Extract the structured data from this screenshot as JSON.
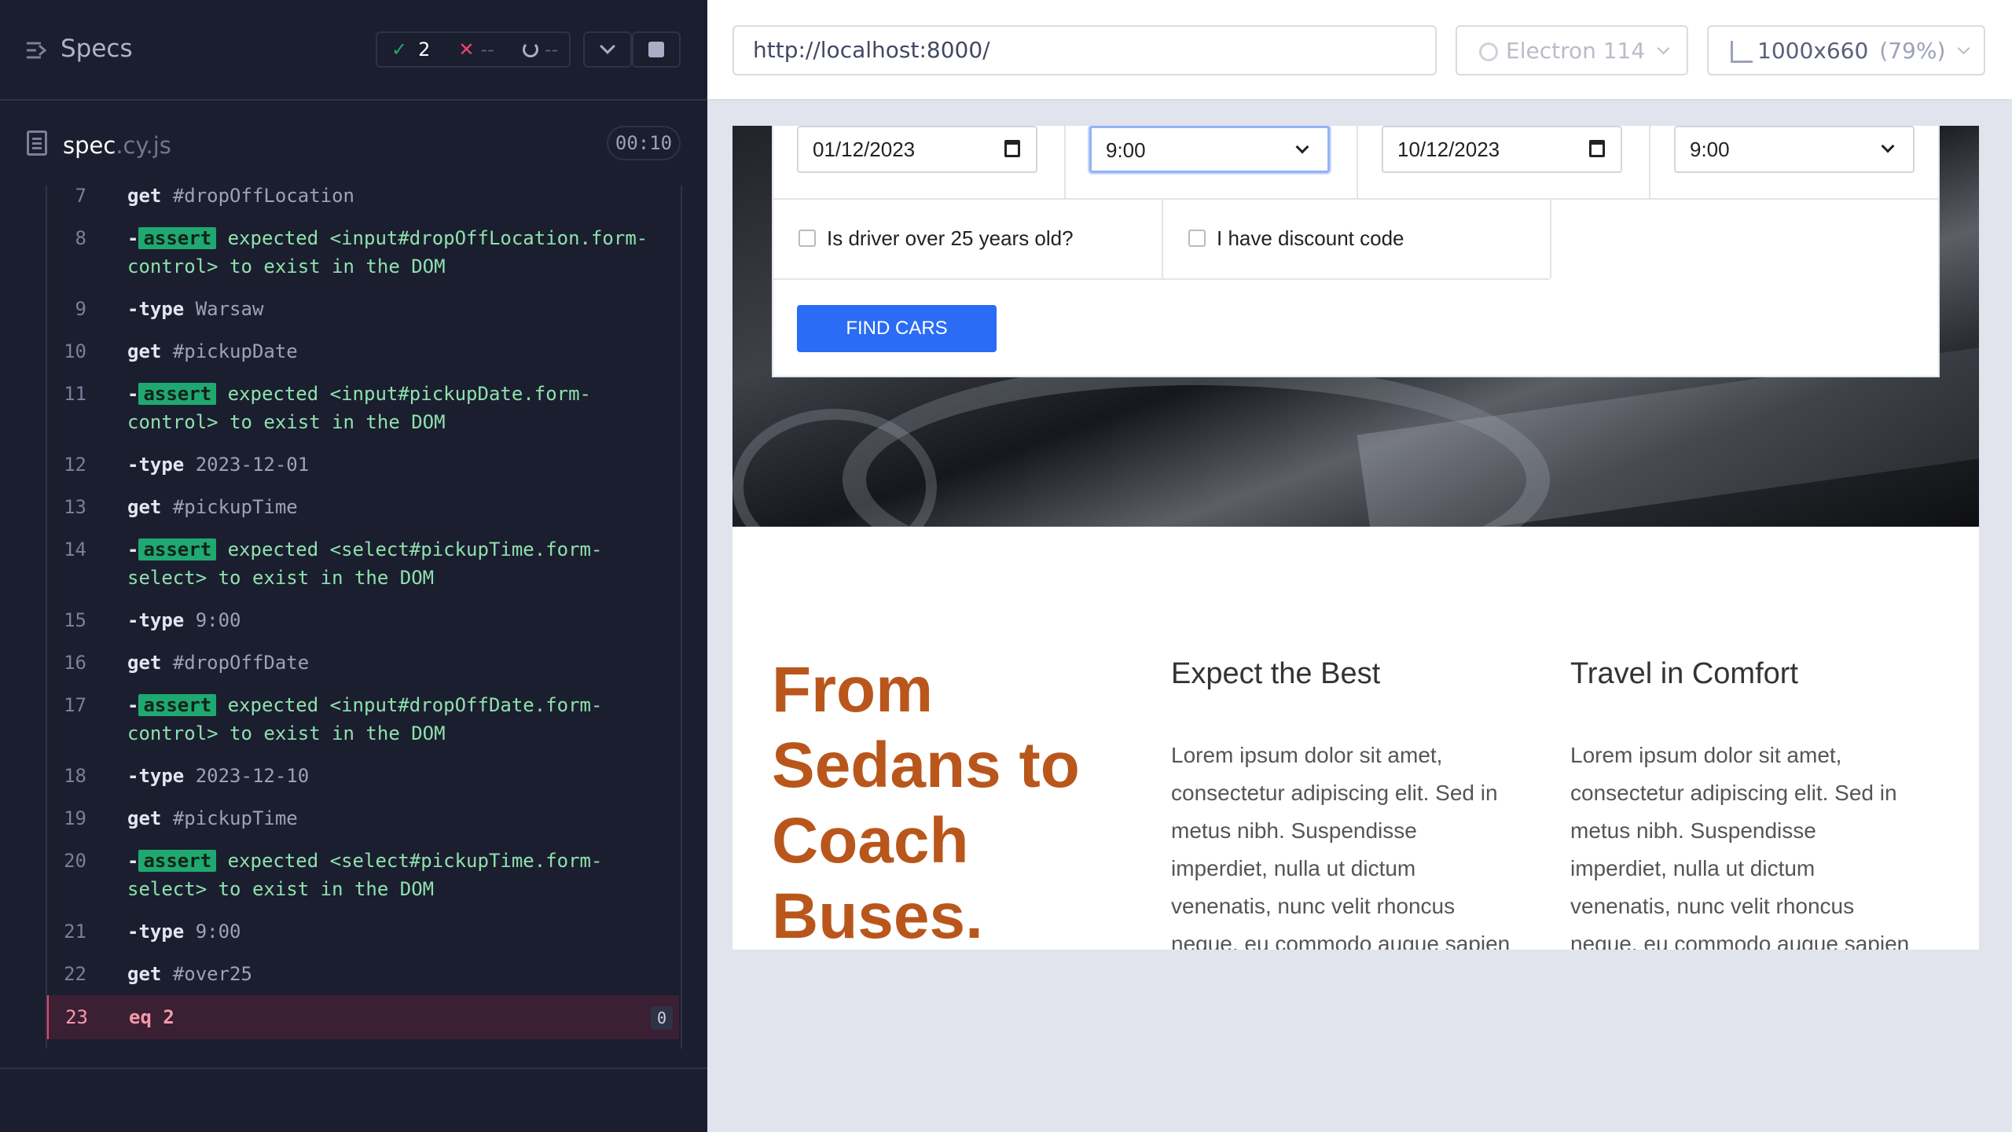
{
  "reporter": {
    "title": "Specs",
    "stats": {
      "passed": "2",
      "failed": "--",
      "pending": "--"
    },
    "spec_file": {
      "name": "spec",
      "ext": ".cy.js"
    },
    "duration": "00:10"
  },
  "commands": [
    {
      "num": "7",
      "name": "get",
      "msg": "#dropOffLocation",
      "kind": "get"
    },
    {
      "num": "8",
      "name": "assert",
      "msg": "expected <input#dropOffLocation.form-control> to exist in the DOM",
      "kind": "assert"
    },
    {
      "num": "9",
      "name": "type",
      "msg": "Warsaw",
      "kind": "child"
    },
    {
      "num": "10",
      "name": "get",
      "msg": "#pickupDate",
      "kind": "get"
    },
    {
      "num": "11",
      "name": "assert",
      "msg": "expected <input#pickupDate.form-control> to exist in the DOM",
      "kind": "assert"
    },
    {
      "num": "12",
      "name": "type",
      "msg": "2023-12-01",
      "kind": "child"
    },
    {
      "num": "13",
      "name": "get",
      "msg": "#pickupTime",
      "kind": "get"
    },
    {
      "num": "14",
      "name": "assert",
      "msg": "expected <select#pickupTime.form-select> to exist in the DOM",
      "kind": "assert"
    },
    {
      "num": "15",
      "name": "type",
      "msg": "9:00",
      "kind": "child"
    },
    {
      "num": "16",
      "name": "get",
      "msg": "#dropOffDate",
      "kind": "get"
    },
    {
      "num": "17",
      "name": "assert",
      "msg": "expected <input#dropOffDate.form-control> to exist in the DOM",
      "kind": "assert"
    },
    {
      "num": "18",
      "name": "type",
      "msg": "2023-12-10",
      "kind": "child"
    },
    {
      "num": "19",
      "name": "get",
      "msg": "#pickupTime",
      "kind": "get"
    },
    {
      "num": "20",
      "name": "assert",
      "msg": "expected <select#pickupTime.form-select> to exist in the DOM",
      "kind": "assert"
    },
    {
      "num": "21",
      "name": "type",
      "msg": "9:00",
      "kind": "child"
    },
    {
      "num": "22",
      "name": "get",
      "msg": "#over25",
      "kind": "get"
    },
    {
      "num": "23",
      "name": "eq",
      "msg": "2",
      "kind": "active",
      "badge": "0"
    }
  ],
  "aut": {
    "url": "http://localhost:8000/",
    "browser": "Electron 114",
    "viewport": "1000x660",
    "scale": "(79%)"
  },
  "page": {
    "pickup_date": "01/12/2023",
    "pickup_time": "9:00",
    "dropoff_date": "10/12/2023",
    "dropoff_time": "9:00",
    "over25_label": "Is driver over 25 years old?",
    "discount_label": "I have discount code",
    "find_button": "FIND CARS",
    "headline": "From Sedans to Coach Buses.",
    "col1_title": "Expect the Best",
    "col1_text": "Lorem ipsum dolor sit amet, consectetur adipiscing elit. Sed in metus nibh. Suspendisse imperdiet, nulla ut dictum venenatis, nunc velit rhoncus neque, eu commodo augue sapien quis ipsum.",
    "col2_title": "Travel in Comfort",
    "col2_text": "Lorem ipsum dolor sit amet, consectetur adipiscing elit. Sed in metus nibh. Suspendisse imperdiet, nulla ut dictum venenatis, nunc velit rhoncus neque, eu commodo augue sapien quis ipsum. Vivamus pharetra"
  },
  "colors": {
    "pass": "#1fa971",
    "fail": "#f0456b",
    "headline": "#b9561b",
    "button": "#2a6cf6"
  },
  "icons": [
    "specs-icon",
    "check-icon",
    "x-icon",
    "spinner-icon",
    "chevron-down-icon",
    "stop-icon",
    "file-icon",
    "electron-icon",
    "viewport-icon",
    "calendar-icon"
  ]
}
